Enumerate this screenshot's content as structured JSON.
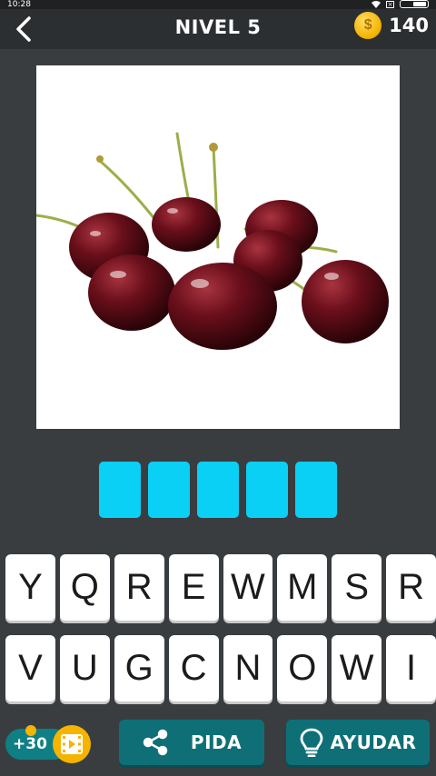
{
  "status_bar": {
    "time": "10:28"
  },
  "header": {
    "title": "NIVEL 5",
    "coins": "140",
    "coin_symbol": "$"
  },
  "picture": {
    "subject_icon": "cherries-photo"
  },
  "answer": {
    "slots": [
      "",
      "",
      "",
      "",
      ""
    ]
  },
  "keyboard": {
    "row1": [
      "Y",
      "Q",
      "R",
      "E",
      "W",
      "M",
      "S",
      "R"
    ],
    "row2": [
      "V",
      "U",
      "G",
      "C",
      "N",
      "O",
      "W",
      "I"
    ]
  },
  "actions": {
    "video_reward": "+30",
    "share_label": "PIDA",
    "help_label": "AYUDAR"
  },
  "colors": {
    "accent": "#0bd0f5",
    "button": "#0f6f76",
    "coin": "#f4b400",
    "background": "#3a3d40"
  }
}
